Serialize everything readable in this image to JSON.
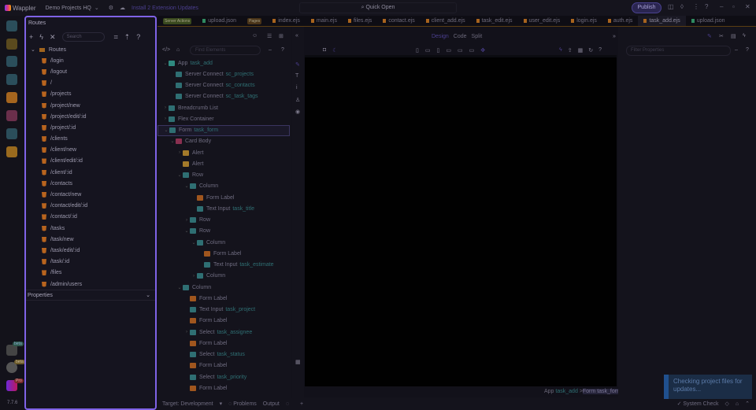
{
  "app": {
    "name": "Wappler",
    "project": "Demo Projects HQ",
    "ext_updates": "Install 2 Extension Updates",
    "quick_open": "Quick Open",
    "publish": "Publish",
    "version": "7.7.6"
  },
  "rail_badges": [
    "beta",
    "beta",
    "Pro"
  ],
  "routes_panel": {
    "title": "Routes",
    "search_placeholder": "Search",
    "root": "Routes",
    "items": [
      "/login",
      "/logout",
      "/",
      "/projects",
      "/project/new",
      "/project/edit/:id",
      "/project/:id",
      "/clients",
      "/client/new",
      "/client/edit/:id",
      "/client/:id",
      "/contacts",
      "/contact/new",
      "/contact/edit/:id",
      "/contact/:id",
      "/tasks",
      "/task/new",
      "/task/edit/:id",
      "/task/:id",
      "/files",
      "/admin/users"
    ],
    "properties_title": "Properties"
  },
  "tabs": [
    {
      "tag": "Server Actions"
    },
    {
      "label": "upload.json"
    },
    {
      "tag": "Pages"
    },
    {
      "label": "index.ejs"
    },
    {
      "label": "main.ejs"
    },
    {
      "label": "files.ejs"
    },
    {
      "label": "contact.ejs"
    },
    {
      "label": "client_add.ejs"
    },
    {
      "label": "task_edit.ejs"
    },
    {
      "label": "user_edit.ejs"
    },
    {
      "label": "login.ejs"
    },
    {
      "label": "auth.ejs"
    },
    {
      "label": "task_add.ejs",
      "active": true
    },
    {
      "label": "upload.json"
    }
  ],
  "tree": {
    "find_placeholder": "Find Elements",
    "rows": [
      {
        "d": 0,
        "c": "v",
        "icon": "#2f8a80",
        "t": "App",
        "id": "task_add"
      },
      {
        "d": 1,
        "c": "",
        "icon": "#2f6f73",
        "t": "Server Connect",
        "id": "sc_projects"
      },
      {
        "d": 1,
        "c": "",
        "icon": "#2f6f73",
        "t": "Server Connect",
        "id": "sc_contacts"
      },
      {
        "d": 1,
        "c": "",
        "icon": "#2f6f73",
        "t": "Server Connect",
        "id": "sc_task_tags"
      },
      {
        "d": 0,
        "c": ">",
        "icon": "#2f6f73",
        "t": "Breadcrumb List",
        "id": ""
      },
      {
        "d": 0,
        "c": ">",
        "icon": "#2f6f73",
        "t": "Flex Container",
        "id": ""
      },
      {
        "d": 0,
        "c": "v",
        "icon": "#2f6f73",
        "t": "Form",
        "id": "task_form",
        "sel": true
      },
      {
        "d": 1,
        "c": "v",
        "icon": "#8a3050",
        "t": "Card Body",
        "id": ""
      },
      {
        "d": 2,
        "c": ">",
        "icon": "#a37a2a",
        "t": "Alert",
        "id": ""
      },
      {
        "d": 2,
        "c": "",
        "icon": "#a37a2a",
        "t": "Alert",
        "id": ""
      },
      {
        "d": 2,
        "c": "v",
        "icon": "#2f6f73",
        "t": "Row",
        "id": ""
      },
      {
        "d": 3,
        "c": "v",
        "icon": "#2f6f73",
        "t": "Column",
        "id": ""
      },
      {
        "d": 4,
        "c": "",
        "icon": "#a0561e",
        "t": "Form Label",
        "id": ""
      },
      {
        "d": 4,
        "c": "",
        "icon": "#2f6f73",
        "t": "Text Input",
        "id": "task_title"
      },
      {
        "d": 3,
        "c": ">",
        "icon": "#2f6f73",
        "t": "Row",
        "id": ""
      },
      {
        "d": 3,
        "c": "v",
        "icon": "#2f6f73",
        "t": "Row",
        "id": ""
      },
      {
        "d": 4,
        "c": "v",
        "icon": "#2f6f73",
        "t": "Column",
        "id": ""
      },
      {
        "d": 5,
        "c": "",
        "icon": "#a0561e",
        "t": "Form Label",
        "id": ""
      },
      {
        "d": 5,
        "c": "",
        "icon": "#2f6f73",
        "t": "Text Input",
        "id": "task_estimate"
      },
      {
        "d": 4,
        "c": ">",
        "icon": "#2f6f73",
        "t": "Column",
        "id": ""
      },
      {
        "d": 2,
        "c": "v",
        "icon": "#2f6f73",
        "t": "Column",
        "id": ""
      },
      {
        "d": 3,
        "c": "",
        "icon": "#a0561e",
        "t": "Form Label",
        "id": ""
      },
      {
        "d": 3,
        "c": "",
        "icon": "#2f6f73",
        "t": "Text Input",
        "id": "task_project"
      },
      {
        "d": 3,
        "c": "",
        "icon": "#a0561e",
        "t": "Form Label",
        "id": ""
      },
      {
        "d": 3,
        "c": ">",
        "icon": "#2f6f73",
        "t": "Select",
        "id": "task_assignee"
      },
      {
        "d": 3,
        "c": "",
        "icon": "#a0561e",
        "t": "Form Label",
        "id": ""
      },
      {
        "d": 3,
        "c": "",
        "icon": "#2f6f73",
        "t": "Select",
        "id": "task_status"
      },
      {
        "d": 3,
        "c": "",
        "icon": "#a0561e",
        "t": "Form Label",
        "id": ""
      },
      {
        "d": 3,
        "c": "",
        "icon": "#2f6f73",
        "t": "Select",
        "id": "task_priority"
      },
      {
        "d": 3,
        "c": "",
        "icon": "#a0561e",
        "t": "Form Label",
        "id": ""
      }
    ]
  },
  "view_modes": [
    "Design",
    "Code",
    "Split"
  ],
  "properties": {
    "filter_placeholder": "Filter Properties"
  },
  "breadcrumb": {
    "a": "App",
    "a_id": "task_add",
    "sep": ">",
    "b": "Form",
    "b_id": "task_form"
  },
  "status": {
    "target": "Target: Development",
    "problems": "Problems",
    "output": "Output",
    "system_check": "System Check"
  },
  "toast": "Checking project files for updates..."
}
